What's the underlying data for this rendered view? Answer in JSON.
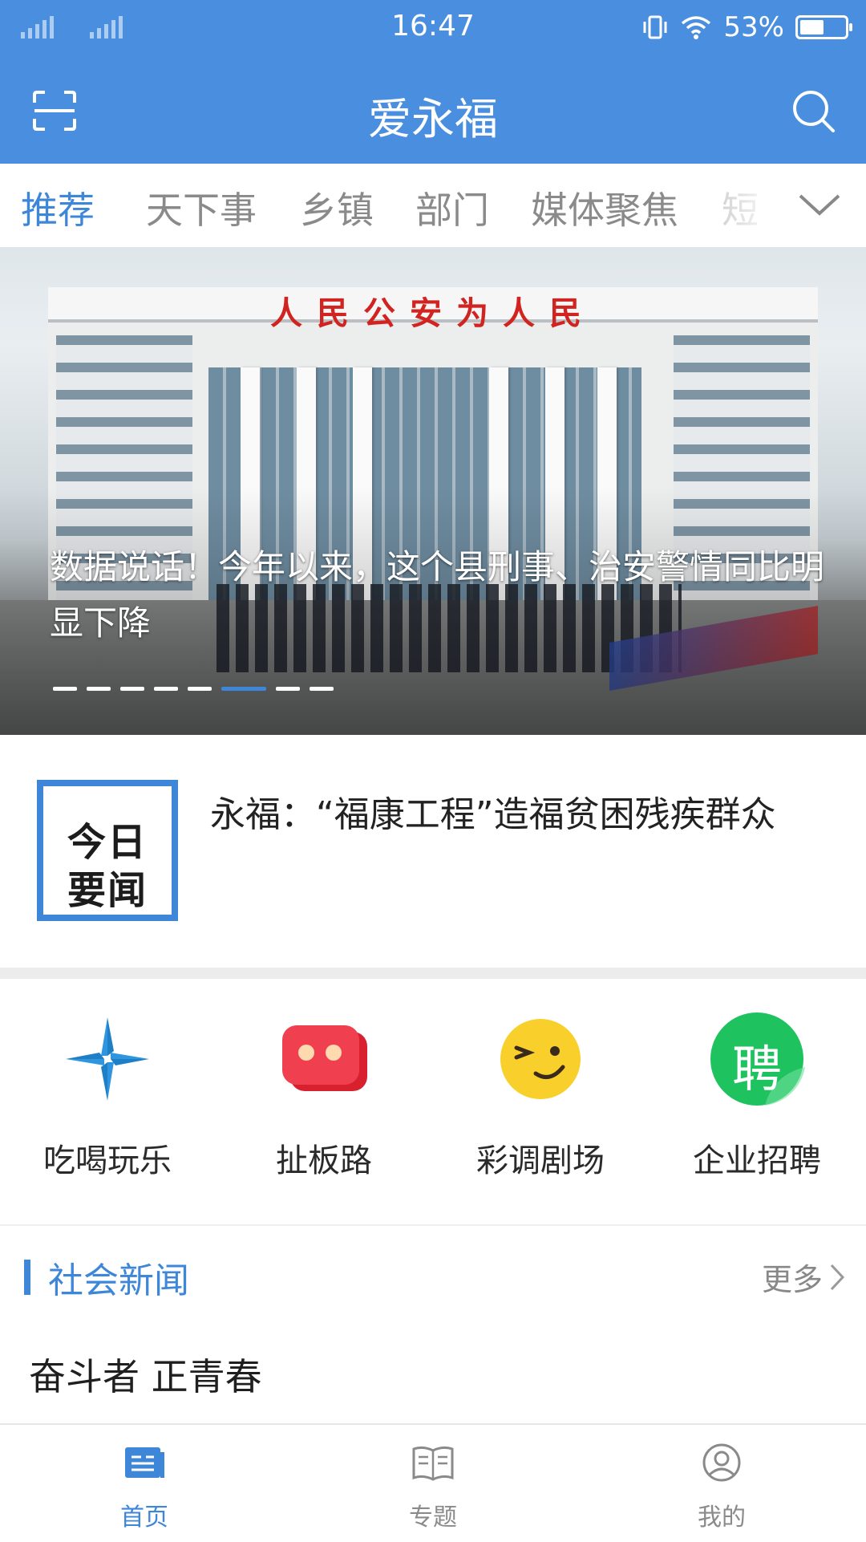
{
  "status_bar": {
    "time": "16:47",
    "battery": "53%",
    "battery_level": 0.53
  },
  "app_bar": {
    "title": "爱永福",
    "scan_icon": "scan-icon",
    "search_icon": "search-icon"
  },
  "tabs": [
    {
      "label": "推荐",
      "active": true
    },
    {
      "label": "天下事"
    },
    {
      "label": "乡镇"
    },
    {
      "label": "部门"
    },
    {
      "label": "媒体聚焦"
    },
    {
      "label": "短"
    }
  ],
  "banner": {
    "sign_text": "人民公安为人民",
    "caption": "数据说话！今年以来，这个县刑事、治安警情同比明显下降",
    "page_count": 8,
    "active_page": 6
  },
  "headline": {
    "badge_line1": "今日",
    "badge_line2": "要闻",
    "text": "永福：“福康工程”造福贫困残疾群众"
  },
  "shortcuts": [
    {
      "label": "吃喝玩乐",
      "icon": "pinwheel-icon"
    },
    {
      "label": "扯板路",
      "icon": "chat-bubble-icon"
    },
    {
      "label": "彩调剧场",
      "icon": "wink-face-icon"
    },
    {
      "label": "企业招聘",
      "icon": "recruit-icon",
      "icon_text": "聘"
    }
  ],
  "section": {
    "title": "社会新闻",
    "more": "更多"
  },
  "news": [
    {
      "title": "奋斗者 正青春"
    }
  ],
  "bottom_nav": [
    {
      "label": "首页",
      "icon": "home-news-icon",
      "active": true
    },
    {
      "label": "专题",
      "icon": "book-icon"
    },
    {
      "label": "我的",
      "icon": "profile-icon"
    }
  ],
  "colors": {
    "brand": "#4a8fdf",
    "accent": "#3d86d8"
  }
}
